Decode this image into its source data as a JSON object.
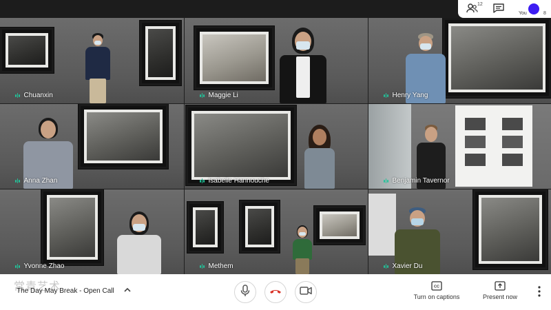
{
  "header": {
    "participants_count": "12",
    "self_label": "You",
    "self_indicator": "8",
    "accent": "#3d1df2"
  },
  "participants": [
    {
      "name": "Chuanxin"
    },
    {
      "name": "Maggie Li"
    },
    {
      "name": "Henry Yang"
    },
    {
      "name": "Anna Zhan"
    },
    {
      "name": "Isabelle Hannouche"
    },
    {
      "name": "Benjamin Tavernor"
    },
    {
      "name": "Yvonne Zhao"
    },
    {
      "name": "Methem"
    },
    {
      "name": "Xavier Du"
    }
  ],
  "footer": {
    "meeting_title": "The Day May Break - Open Call",
    "watermark": "常青艺术",
    "captions_label": "Turn on captions",
    "present_label": "Present now",
    "mic_icon": "microphone-icon",
    "end_call_icon": "hang-up-icon",
    "camera_icon": "camera-icon",
    "end_call_color": "#d93025",
    "speaking_color": "#22c39a"
  }
}
